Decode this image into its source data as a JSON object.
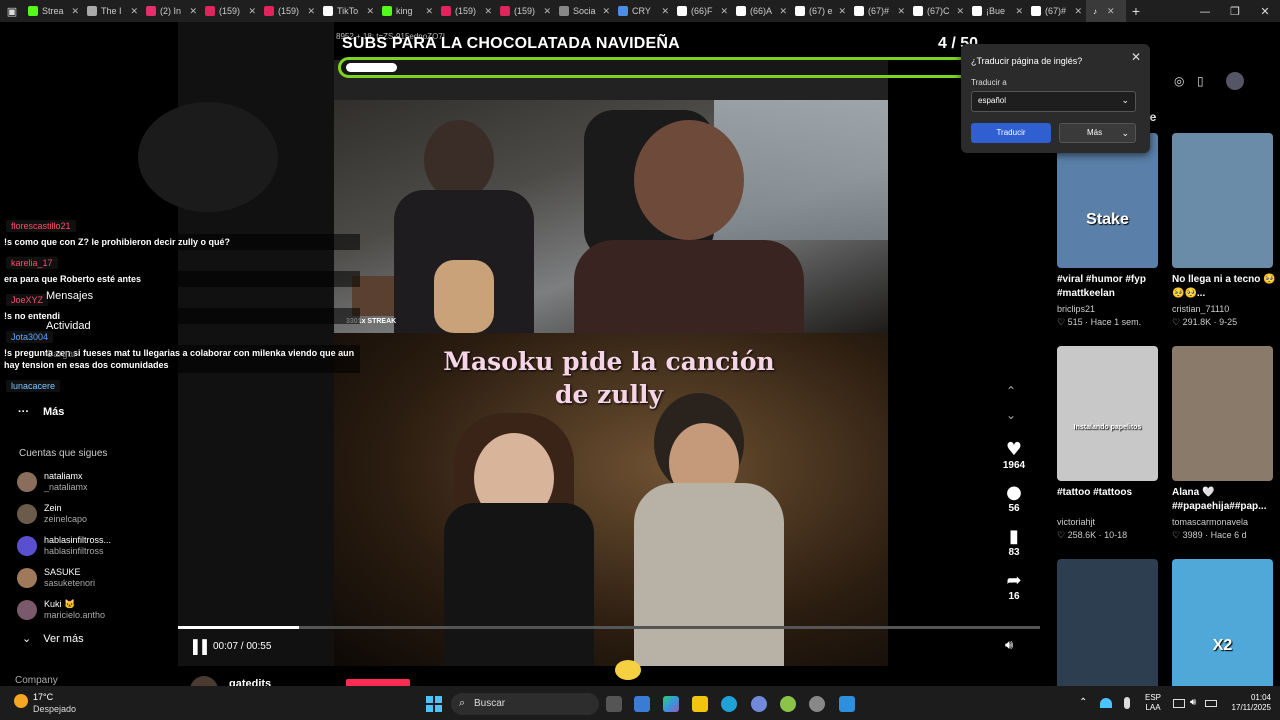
{
  "browser": {
    "tabs": [
      {
        "title": "Strea",
        "icon": "kick-icon",
        "color": "#53fc18"
      },
      {
        "title": "The I",
        "icon": "diamond-icon",
        "color": "#aaaaaa"
      },
      {
        "title": "(2) In",
        "icon": "instagram-icon",
        "color": "#e1306c"
      },
      {
        "title": "(159)",
        "icon": "dot-icon",
        "color": "#e0245e"
      },
      {
        "title": "(159)",
        "icon": "dot-icon",
        "color": "#e0245e"
      },
      {
        "title": "TikTo",
        "icon": "tiktok-icon",
        "color": "#ffffff"
      },
      {
        "title": "king",
        "icon": "kick-icon",
        "color": "#53fc18"
      },
      {
        "title": "(159)",
        "icon": "dot-icon",
        "color": "#e0245e"
      },
      {
        "title": "(159)",
        "icon": "dot-icon",
        "color": "#e0245e"
      },
      {
        "title": "Socia",
        "icon": "dash-icon",
        "color": "#888888"
      },
      {
        "title": "CRY",
        "icon": "search-icon",
        "color": "#4a90e2"
      },
      {
        "title": "(66)F",
        "icon": "tiktok-icon",
        "color": "#ffffff"
      },
      {
        "title": "(66)A",
        "icon": "tiktok-icon",
        "color": "#ffffff"
      },
      {
        "title": "(67) e",
        "icon": "tiktok-icon",
        "color": "#ffffff"
      },
      {
        "title": "(67)#",
        "icon": "tiktok-icon",
        "color": "#ffffff"
      },
      {
        "title": "(67)C",
        "icon": "tiktok-icon",
        "color": "#ffffff"
      },
      {
        "title": "¡Bue",
        "icon": "tiktok-icon",
        "color": "#ffffff"
      },
      {
        "title": "(67)#",
        "icon": "tiktok-icon",
        "color": "#ffffff"
      }
    ]
  },
  "overlay": {
    "stream_id": "8952 + 18: t=ZS-915ednoZO7I",
    "title": "SUBS PARA LA CHOCOLATADA NAVIDEÑA",
    "count": "4 / 50",
    "goal_fraction": 0.08
  },
  "video": {
    "caption": "Masoku pide la canción de zully",
    "streak_label": "3301x STREAK",
    "time": "00:07 / 00:55",
    "progress_fraction": 0.14
  },
  "chat": [
    {
      "user": "florescastillo21",
      "user_color": "#ff4d6d",
      "message": "!s como que con Z? le prohibieron decir zully o qué?"
    },
    {
      "user": "karelia_17",
      "user_color": "#ff4d6d",
      "message": "era para que Roberto esté antes"
    },
    {
      "user": "JoeXYZ",
      "user_color": "#ff4d6d",
      "message": "!s no entendi"
    },
    {
      "user": "Jota3004",
      "user_color": "#5aa9ff",
      "message": "!s pregunta zen si fueses mat tu llegarias a colaborar con milenka viendo que aun hay tension en esas dos comunidades"
    },
    {
      "user": "lunacacere",
      "user_color": "#7ec8ff",
      "message": ""
    }
  ],
  "sidebar": {
    "nav_mensajes": "Mensajes",
    "nav_actividad": "Actividad",
    "nav_cargar": "Cargar",
    "more": "Más",
    "following_title": "Cuentas que sigues",
    "following": [
      {
        "name": "nataliamx",
        "handle": "_nataliamx",
        "color": "#8a6d5a"
      },
      {
        "name": "Zein",
        "handle": "zeinelcapo",
        "color": "#6b5b4b"
      },
      {
        "name": "hablasinfiltross...",
        "handle": "hablasinfiltross",
        "color": "#5a4fcf"
      },
      {
        "name": "SASUKE",
        "handle": "sasuketenori",
        "color": "#a0785a"
      },
      {
        "name": "Kuki 🐱",
        "handle": "maricielo.antho",
        "color": "#7a5a6a"
      }
    ],
    "see_more": "Ver más",
    "company": "Company"
  },
  "actions": {
    "likes": "1964",
    "comments": "56",
    "saves": "83",
    "shares": "16"
  },
  "translate_popup": {
    "title": "¿Traducir página de inglés?",
    "label": "Traducir a",
    "selected_language": "español",
    "translate_button": "Traducir",
    "more_button": "Más"
  },
  "right_panel": {
    "header": "rte",
    "cards": [
      {
        "title": "#viral #humor #fyp #mattkeelan",
        "user": "briclips21",
        "meta": "♡ 515 · Hace 1 sem.",
        "thumb_color": "#5a7fa8",
        "thumb_text": "Stake"
      },
      {
        "title": "No llega ni a tecno 🥺🥺🥺...",
        "user": "cristian_71110",
        "meta": "♡ 291.8K · 9-25",
        "thumb_color": "#6b8ca8",
        "thumb_text": ""
      },
      {
        "title": "#tattoo #tattoos",
        "user": "victoriahjt",
        "meta": "♡ 258.6K · 10-18",
        "thumb_color": "#c8c8c8",
        "thumb_text": "Instalando papelitos"
      },
      {
        "title": "Alana 🤍 ##papaehija##pap...",
        "user": "tomascarmonavela",
        "meta": "♡ 3989 · Hace 6 d",
        "thumb_color": "#8a7a6a",
        "thumb_text": ""
      },
      {
        "title": "",
        "user": "",
        "meta": "",
        "thumb_color": "#2c3e50",
        "thumb_text": ""
      },
      {
        "title": "",
        "user": "",
        "meta": "",
        "thumb_color": "#4fa8d8",
        "thumb_text": "X2"
      }
    ]
  },
  "bottom": {
    "username": "gatedits"
  },
  "taskbar": {
    "temperature": "17°C",
    "weather": "Despejado",
    "search_placeholder": "Buscar",
    "lang_top": "ESP",
    "lang_bottom": "LAA",
    "time": "01:04",
    "date": "17/11/2025"
  }
}
